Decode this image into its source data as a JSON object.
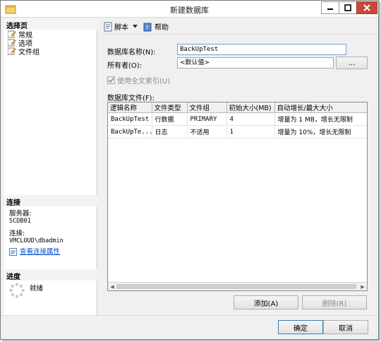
{
  "window": {
    "title": "新建数据库"
  },
  "left_panel": {
    "select_page_header": "选择页",
    "pages": [
      {
        "label": "常规"
      },
      {
        "label": "选项"
      },
      {
        "label": "文件组"
      }
    ],
    "connection_header": "连接",
    "server_label": "服务器:",
    "server_value": "SCDB01",
    "connection_label": "连接:",
    "connection_value": "VMCLOUD\\dbadmin",
    "view_connection_link": "查看连接属性",
    "progress_header": "进度",
    "progress_status": "就绪"
  },
  "toolbar": {
    "script_label": "脚本",
    "help_label": "帮助"
  },
  "form": {
    "db_name_label": "数据库名称(N):",
    "db_name_value": "BackUpTest",
    "owner_label": "所有者(O):",
    "owner_value": "<默认值>",
    "browse_label": "...",
    "fulltext_label": "使用全文索引(U)",
    "files_label": "数据库文件(F):"
  },
  "files_table": {
    "columns": [
      "逻辑名称",
      "文件类型",
      "文件组",
      "初始大小(MB)",
      "自动增长/最大大小"
    ],
    "rows": [
      {
        "logical_name": "BackUpTest",
        "file_type": "行数据",
        "filegroup": "PRIMARY",
        "initial_size": "4",
        "autogrowth": "增量为 1 MB，增长无限制"
      },
      {
        "logical_name": "BackUpTe...",
        "file_type": "日志",
        "filegroup": "不适用",
        "initial_size": "1",
        "autogrowth": "增量为 10%，增长无限制"
      }
    ]
  },
  "buttons": {
    "add_label": "添加(A)",
    "remove_label": "删除(R)",
    "ok_label": "确定",
    "cancel_label": "取消"
  }
}
